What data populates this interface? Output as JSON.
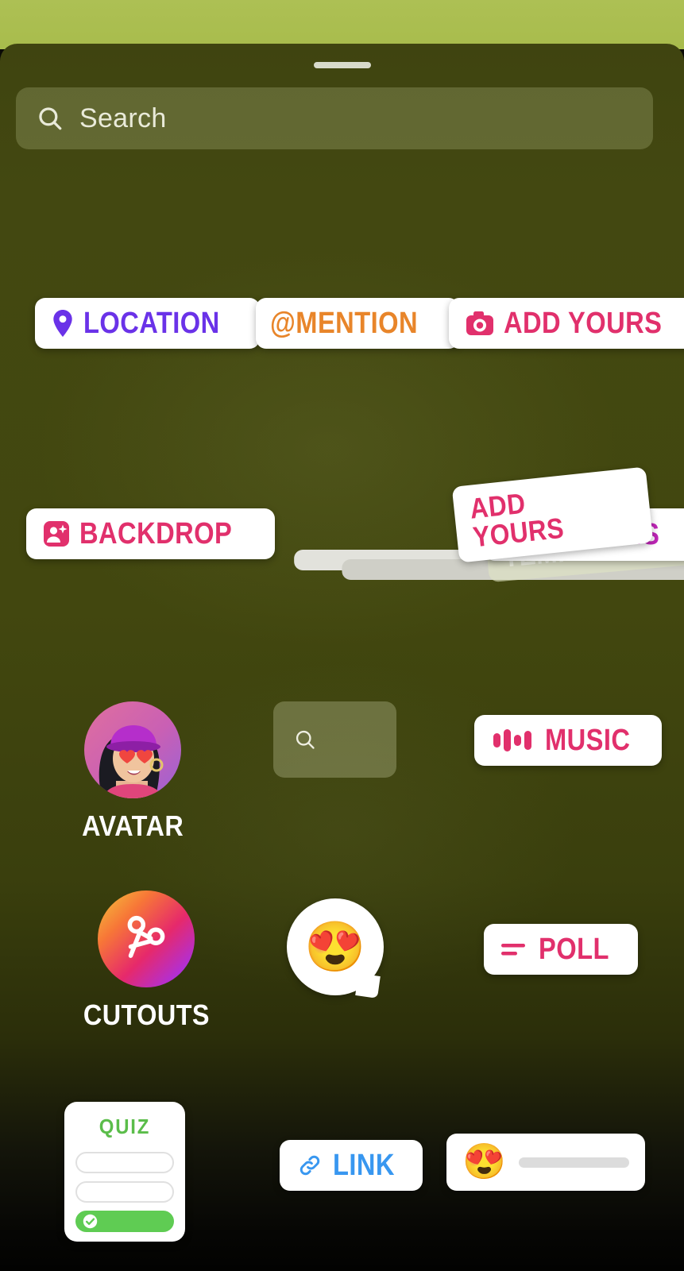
{
  "sheet": {
    "grabber_name": "drag-handle",
    "background_color": "#42470f",
    "top_strip_color": "#a8bc4c"
  },
  "search": {
    "placeholder": "Search",
    "icon": "search-icon"
  },
  "stickers": {
    "location": {
      "label": "LOCATION",
      "color": "#6a32e8",
      "icon": "location-pin-icon"
    },
    "mention": {
      "label": "@MENTION",
      "color": "#e8852a",
      "icon": "at-mention-icon"
    },
    "add_yours": {
      "label": "ADD YOURS",
      "color": "#e1306c",
      "icon": "camera-icon"
    },
    "backdrop": {
      "label": "BACKDROP",
      "color": "#e1306c",
      "icon": "backdrop-person-sparkle-icon"
    },
    "questions": {
      "label": "QUESTIONS",
      "color": "#c026b8"
    },
    "add_yours_template": {
      "label": "ADD YOURS",
      "color": "#e1306c"
    },
    "templates": {
      "label": "TEMPLATES",
      "color": "#f2f4e6"
    },
    "avatar": {
      "label": "AVATAR",
      "icon": "avatar-image"
    },
    "gif": {
      "icon": "search-icon"
    },
    "music": {
      "label": "MUSIC",
      "color": "#e1306c",
      "icon": "music-bars-icon"
    },
    "cutouts": {
      "label": "CUTOUTS",
      "icon": "scissors-icon"
    },
    "emoji_reaction": {
      "emoji": "😍",
      "icon": "emoji-bubble"
    },
    "poll": {
      "label": "POLL",
      "color": "#e1306c",
      "icon": "poll-bars-icon"
    },
    "quiz": {
      "label": "QUIZ",
      "color": "#5bbd4a",
      "options_count": "3",
      "icon": "check-icon"
    },
    "link": {
      "label": "LINK",
      "color": "#3897f0",
      "icon": "link-chain-icon"
    },
    "emoji_slider": {
      "emoji": "😍",
      "icon": "emoji-slider"
    }
  }
}
